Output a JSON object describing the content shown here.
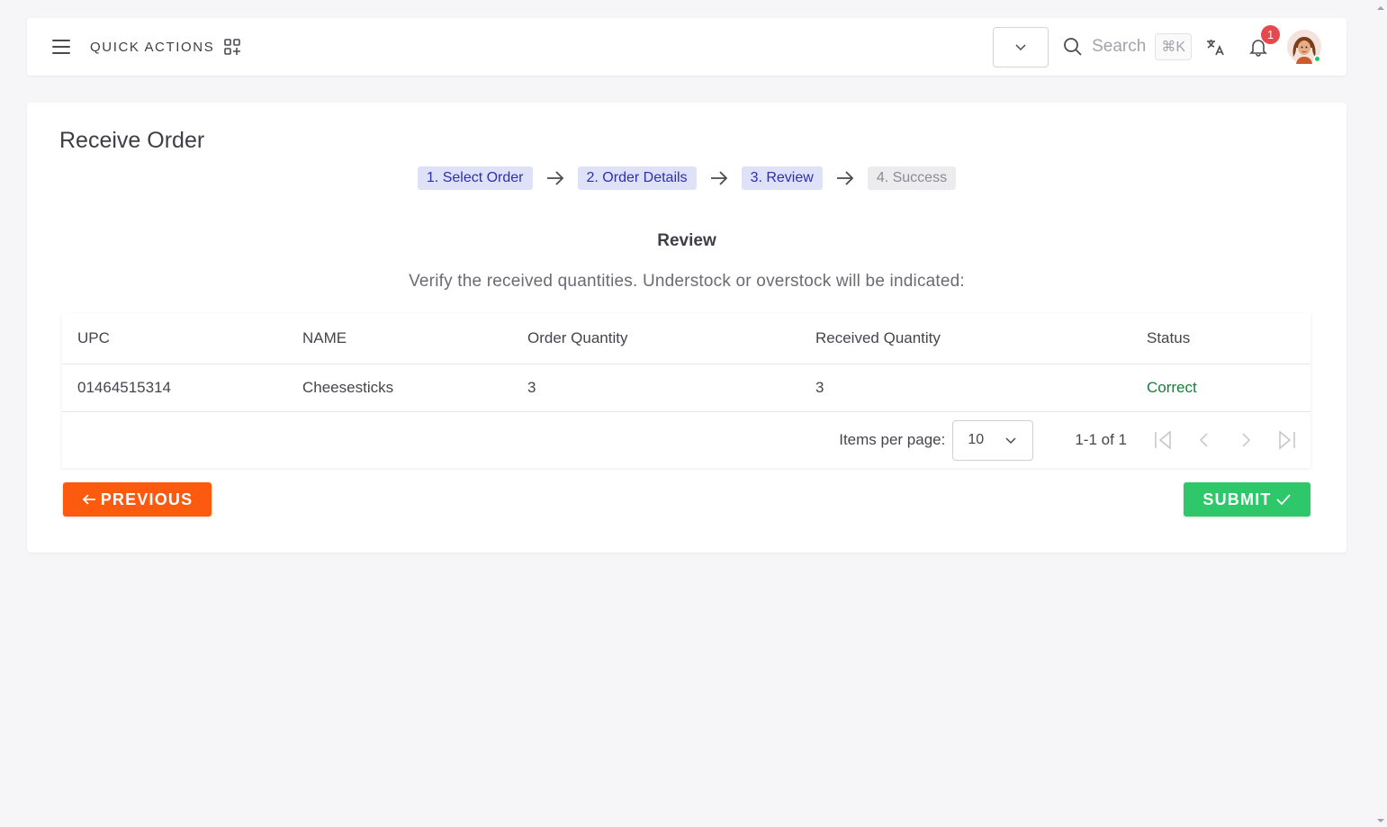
{
  "header": {
    "quick_actions_label": "QUICK ACTIONS",
    "search_placeholder": "Search",
    "search_shortcut": "⌘K",
    "notification_count": "1"
  },
  "page": {
    "title": "Receive Order",
    "steps": [
      {
        "label": "1. Select Order",
        "state": "done"
      },
      {
        "label": "2. Order Details",
        "state": "done"
      },
      {
        "label": "3. Review",
        "state": "active"
      },
      {
        "label": "4. Success",
        "state": "pending"
      }
    ],
    "section_title": "Review",
    "section_description": "Verify the received quantities. Understock or overstock will be indicated:"
  },
  "table": {
    "columns": [
      "UPC",
      "NAME",
      "Order Quantity",
      "Received Quantity",
      "Status"
    ],
    "rows": [
      {
        "upc": "01464515314",
        "name": "Cheesesticks",
        "order_qty": "3",
        "received_qty": "3",
        "status": "Correct"
      }
    ],
    "paginator": {
      "items_per_page_label": "Items per page:",
      "items_per_page": "10",
      "range": "1-1 of 1"
    }
  },
  "actions": {
    "previous_label": "PREVIOUS",
    "submit_label": "SUBMIT"
  },
  "colors": {
    "previous_button": "#fb5a0f",
    "submit_button": "#2ec76a",
    "status_correct": "#15803d",
    "step_active_bg": "#dfe1f8",
    "notification_badge": "#e5484d"
  }
}
